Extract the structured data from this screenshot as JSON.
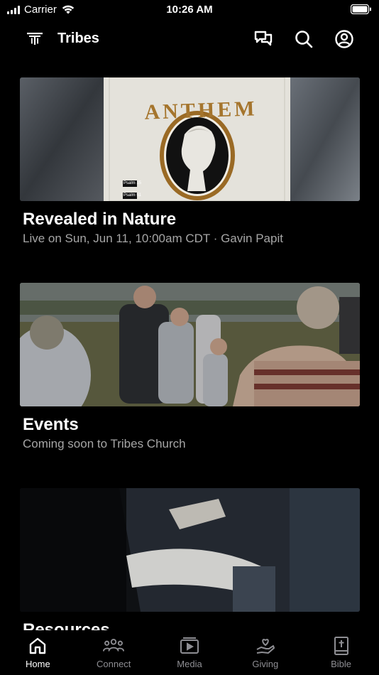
{
  "status_bar": {
    "carrier": "Carrier",
    "time": "10:26 AM"
  },
  "header": {
    "title": "Tribes",
    "logo_icon": "tribes-logo-icon",
    "actions": [
      "chat-icon",
      "search-icon",
      "account-icon"
    ]
  },
  "cards": [
    {
      "title": "Revealed in Nature",
      "subtitle": "Live on Sun, Jun 11, 10:00am CDT · Gavin Papit",
      "image_caption": "ANTHEM",
      "image_small_1": "Psalm 15",
      "image_small_2": "Psalm 51"
    },
    {
      "title": "Events",
      "subtitle": "Coming soon to Tribes Church"
    },
    {
      "title": "Resources",
      "subtitle": ""
    }
  ],
  "tabs": [
    {
      "label": "Home",
      "icon": "home-icon",
      "active": true
    },
    {
      "label": "Connect",
      "icon": "people-icon",
      "active": false
    },
    {
      "label": "Media",
      "icon": "media-icon",
      "active": false
    },
    {
      "label": "Giving",
      "icon": "giving-icon",
      "active": false
    },
    {
      "label": "Bible",
      "icon": "bible-icon",
      "active": false
    }
  ],
  "colors": {
    "background": "#000000",
    "text_primary": "#ffffff",
    "text_secondary": "#a6a6a6",
    "tab_inactive": "#8e8e93"
  }
}
